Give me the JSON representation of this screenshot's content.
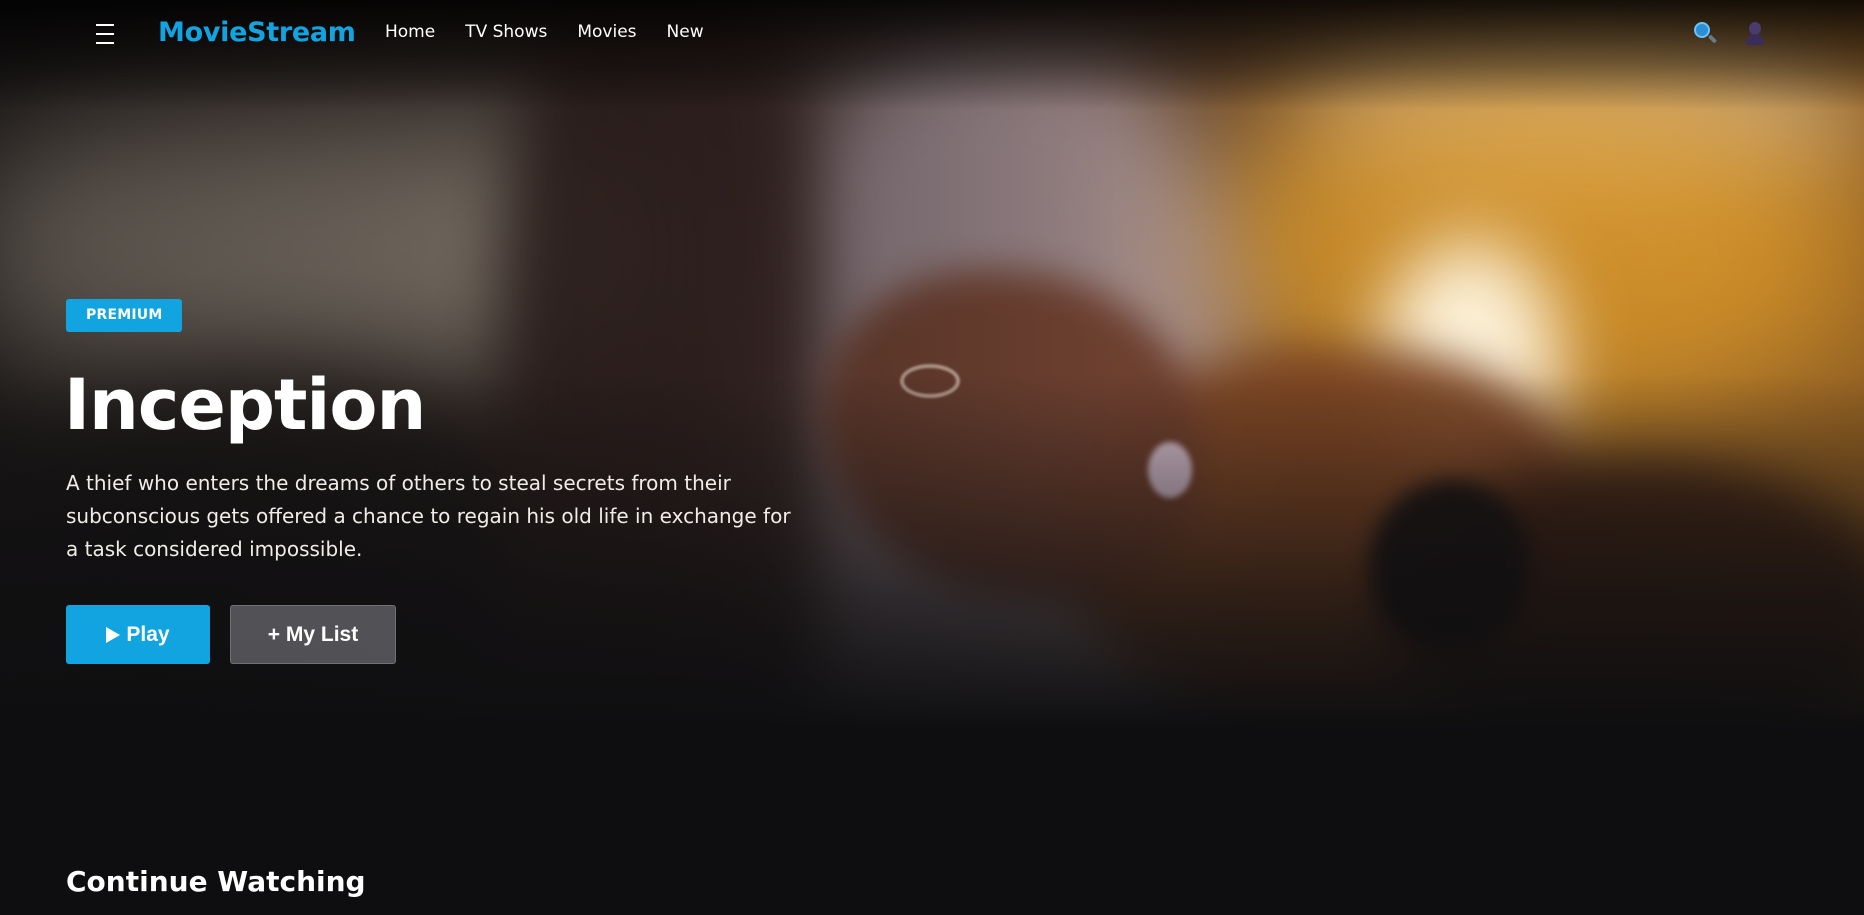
{
  "app": {
    "logo": "MovieStream",
    "brand_color": "#12a4e0"
  },
  "nav": {
    "links": [
      "Home",
      "TV Shows",
      "Movies",
      "New"
    ],
    "icons": {
      "menu": "menu-icon",
      "search": "search-icon",
      "user": "user-icon"
    }
  },
  "hero": {
    "badge": "PREMIUM",
    "title": "Inception",
    "description": "A thief who enters the dreams of others to steal secrets from their subconscious gets offered a chance to regain his old life in exchange for a task considered impossible.",
    "play_label": "Play",
    "mylist_label": "+ My List"
  },
  "sections": {
    "continue_watching": "Continue Watching"
  }
}
